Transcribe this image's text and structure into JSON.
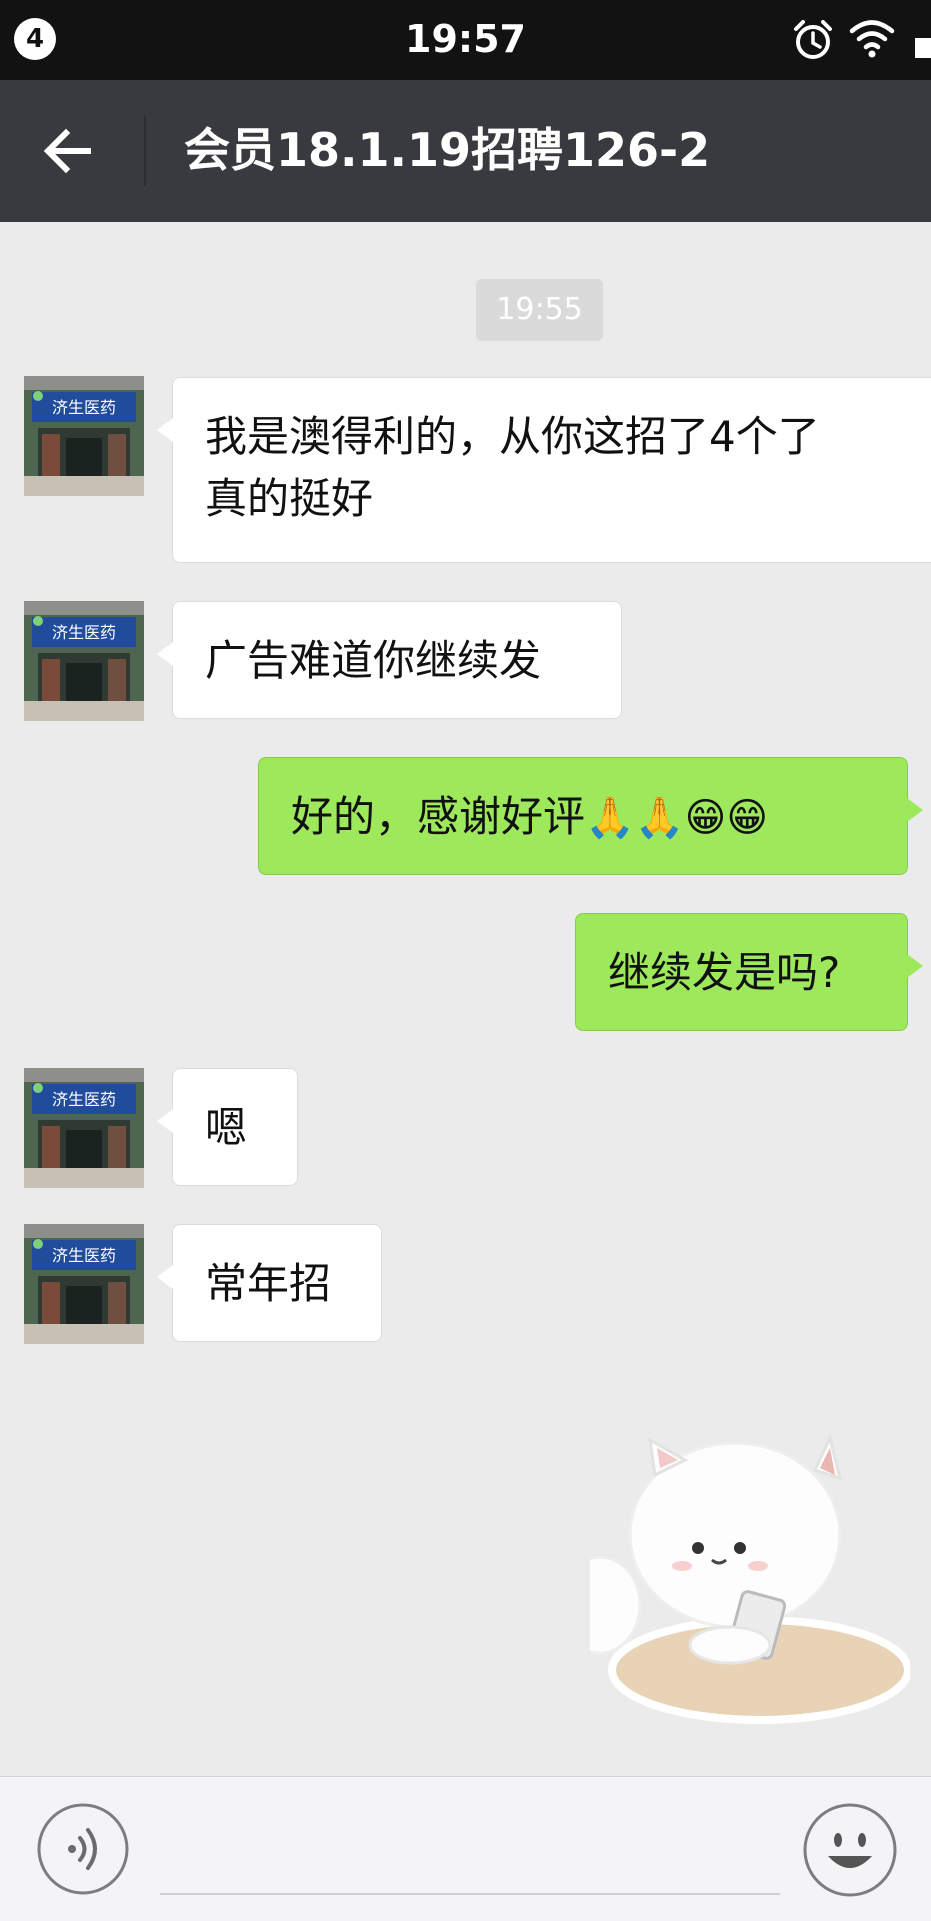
{
  "status_bar": {
    "notification_count": "4",
    "time": "19:57"
  },
  "header": {
    "title": "会员18.1.19招聘126-2"
  },
  "chat": {
    "timestamp": "19:55",
    "messages": [
      {
        "side": "in",
        "line1": "我是澳得利的，从你这招了4个了",
        "line2": "真的挺好"
      },
      {
        "side": "in",
        "text": "广告难道你继续发"
      },
      {
        "side": "out",
        "text": "好的，感谢好评",
        "emoji": "🙏🙏😁😁"
      },
      {
        "side": "out",
        "text": "继续发是吗?"
      },
      {
        "side": "in",
        "text": "嗯"
      },
      {
        "side": "in",
        "text": "常年招"
      }
    ],
    "avatar_sign_text": "济生医药"
  },
  "colors": {
    "status_bar": "#121212",
    "title_bar": "#393a3f",
    "chat_background": "#ebebeb",
    "incoming_bubble": "#ffffff",
    "outgoing_bubble": "#9ee85c"
  },
  "icons": {
    "back": "arrow-left-icon",
    "alarm": "alarm-clock-icon",
    "wifi": "wifi-icon",
    "voice": "voice-input-icon",
    "emoji": "emoji-smile-icon"
  }
}
